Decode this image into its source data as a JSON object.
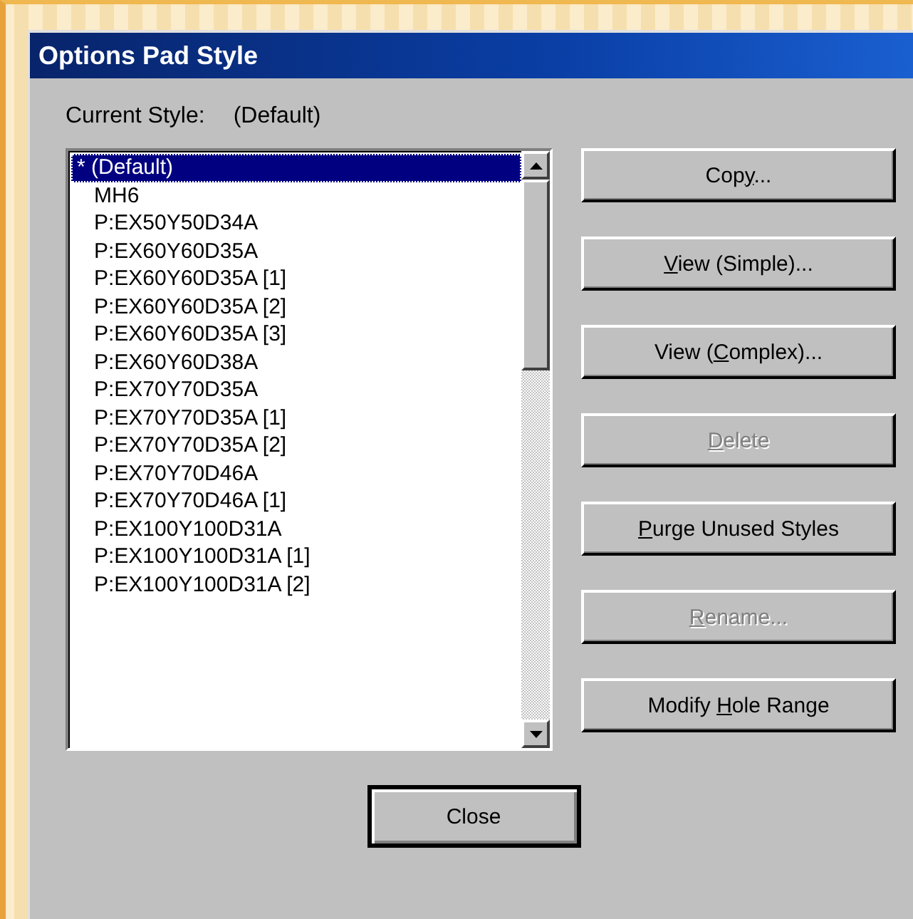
{
  "window": {
    "title": "Options Pad Style"
  },
  "current_style": {
    "label": "Current Style:",
    "value": "(Default)"
  },
  "styles_list": {
    "items": [
      {
        "text": "* (Default)",
        "selected": true
      },
      {
        "text": "MH6",
        "selected": false
      },
      {
        "text": "P:EX50Y50D34A",
        "selected": false
      },
      {
        "text": "P:EX60Y60D35A",
        "selected": false
      },
      {
        "text": "P:EX60Y60D35A [1]",
        "selected": false
      },
      {
        "text": "P:EX60Y60D35A [2]",
        "selected": false
      },
      {
        "text": "P:EX60Y60D35A [3]",
        "selected": false
      },
      {
        "text": "P:EX60Y60D38A",
        "selected": false
      },
      {
        "text": "P:EX70Y70D35A",
        "selected": false
      },
      {
        "text": "P:EX70Y70D35A [1]",
        "selected": false
      },
      {
        "text": "P:EX70Y70D35A [2]",
        "selected": false
      },
      {
        "text": "P:EX70Y70D46A",
        "selected": false
      },
      {
        "text": "P:EX70Y70D46A [1]",
        "selected": false
      },
      {
        "text": "P:EX100Y100D31A",
        "selected": false
      },
      {
        "text": "P:EX100Y100D31A [1]",
        "selected": false
      },
      {
        "text": "P:EX100Y100D31A [2]",
        "selected": false
      }
    ]
  },
  "buttons": [
    {
      "label": [
        {
          "text": "Cop"
        },
        {
          "text": "y",
          "underlined": true
        },
        {
          "text": "..."
        }
      ],
      "disabled": false
    },
    {
      "label": [
        {
          "text": "V",
          "underlined": true
        },
        {
          "text": "iew (Simple)..."
        }
      ],
      "disabled": false
    },
    {
      "label": [
        {
          "text": "View ("
        },
        {
          "text": "C",
          "underlined": true
        },
        {
          "text": "omplex)..."
        }
      ],
      "disabled": false
    },
    {
      "label": [
        {
          "text": "D",
          "underlined": true
        },
        {
          "text": "elete"
        }
      ],
      "disabled": true
    },
    {
      "label": [
        {
          "text": "P",
          "underlined": true
        },
        {
          "text": "urge Unused Styles"
        }
      ],
      "disabled": false
    },
    {
      "label": [
        {
          "text": "R",
          "underlined": true
        },
        {
          "text": "ename..."
        }
      ],
      "disabled": true
    },
    {
      "label": [
        {
          "text": "Modify "
        },
        {
          "text": "H",
          "underlined": true
        },
        {
          "text": "ole Range"
        }
      ],
      "disabled": false
    }
  ],
  "close_button": {
    "label": "Close"
  }
}
